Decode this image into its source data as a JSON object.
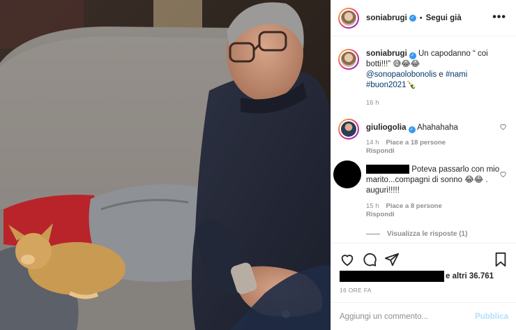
{
  "header": {
    "username": "soniabrugi",
    "separator": "•",
    "follow_state": "Segui già",
    "more_glyph": "•••"
  },
  "caption": {
    "username": "soniabrugi",
    "text_before": "Un capodanno “ coi botti!!!” 😅😂😂",
    "mention": "@sonopaolobonolis",
    "joiner": " e ",
    "tag1": "#nami",
    "tag2": "#buon2021",
    "emoji_end": "🍾",
    "time": "16 h"
  },
  "comments": [
    {
      "username": "giuliogolia",
      "text": "Ahahahaha",
      "time": "14 h",
      "likes": "Piace a 18 persone",
      "reply": "Rispondi"
    },
    {
      "username_redacted": true,
      "text": "Poteva passarlo con mio marito...compagni di sonno 😂😂 . auguri!!!!!",
      "time": "15 h",
      "likes": "Piace a 8 persone",
      "reply": "Rispondi",
      "view_replies": "Visualizza le risposte (1)"
    }
  ],
  "likes": {
    "suffix": "e altri 36.761"
  },
  "date": "16 ORE FA",
  "comment_box": {
    "placeholder": "Aggiungi un commento...",
    "publish": "Pubblica"
  },
  "icons": [
    "heart-icon",
    "comment-icon",
    "share-icon",
    "bookmark-icon",
    "more-options-icon",
    "verified-badge-icon"
  ],
  "colors": {
    "verified": "#3897f0",
    "link": "#00376b",
    "muted": "#8e8e8e",
    "publish_disabled": "#b2dffc"
  }
}
